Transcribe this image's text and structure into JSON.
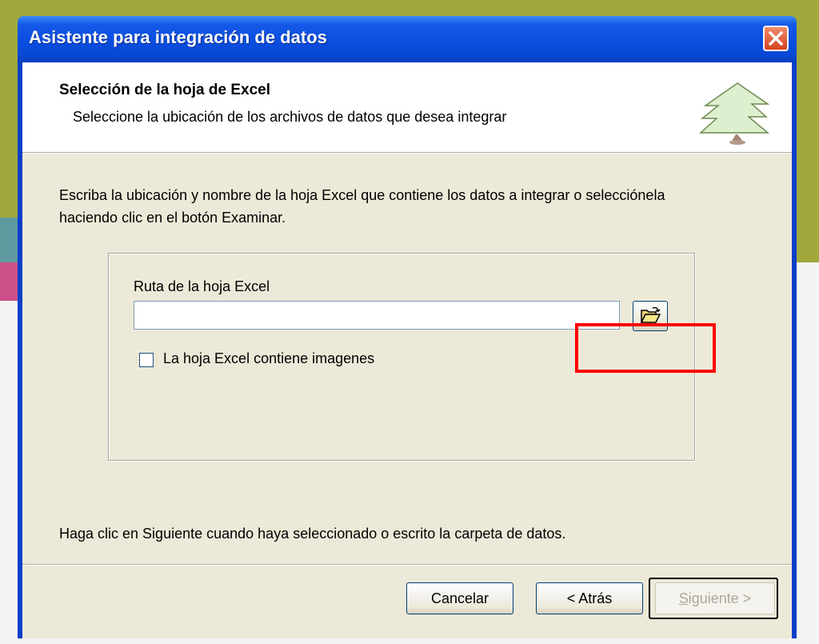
{
  "window": {
    "title": "Asistente para integración de datos",
    "close_icon": "close-icon"
  },
  "header": {
    "title": "Selección de la hoja de Excel",
    "subtitle": "Seleccione la ubicación de los archivos de datos que desea integrar",
    "icon": "tree-icon"
  },
  "body": {
    "intro": "Escriba la ubicación y nombre de la hoja Excel que contiene los datos a integrar o selecciónela haciendo clic en el botón Examinar.",
    "path_label": "Ruta de la hoja Excel",
    "path_value": "",
    "browse_icon": "open-folder-icon",
    "checkbox_label": "La hoja Excel contiene imagenes",
    "checkbox_checked": false,
    "footer": "Haga clic en Siguiente cuando haya seleccionado o escrito la carpeta de datos."
  },
  "buttons": {
    "cancel": "Cancelar",
    "back": "< Atrás",
    "next_underlined": "S",
    "next_rest": "iguiente >"
  },
  "colors": {
    "highlight": "#ff0000",
    "title_bar": "#0a4ee0",
    "dialog_bg": "#ece9d8"
  }
}
